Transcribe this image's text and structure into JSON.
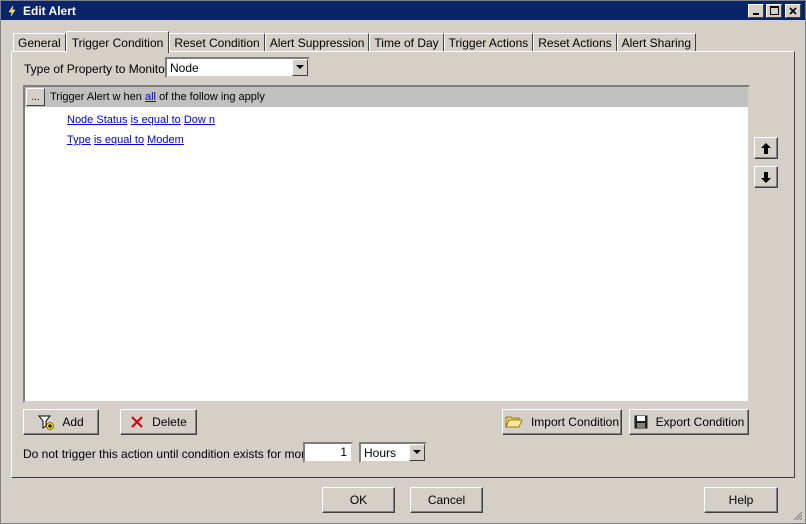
{
  "window": {
    "title": "Edit Alert"
  },
  "tabs": [
    {
      "label": "General"
    },
    {
      "label": "Trigger Condition"
    },
    {
      "label": "Reset Condition"
    },
    {
      "label": "Alert Suppression"
    },
    {
      "label": "Time of Day"
    },
    {
      "label": "Trigger Actions"
    },
    {
      "label": "Reset Actions"
    },
    {
      "label": "Alert Sharing"
    }
  ],
  "active_tab": "Trigger Condition",
  "property": {
    "label": "Type of Property to Monitor:",
    "value": "Node"
  },
  "condition": {
    "ellipsis": "...",
    "header_prefix": "Trigger Alert w hen",
    "header_link": "all",
    "header_suffix": "of the follow ing apply",
    "rules": [
      {
        "field": "Node Status",
        "op": "is equal to",
        "value": "Dow n"
      },
      {
        "field": "Type",
        "op": "is equal to",
        "value": "Modem"
      }
    ]
  },
  "buttons": {
    "add": "Add",
    "delete": "Delete",
    "import": "Import Condition",
    "export": "Export Condition",
    "ok": "OK",
    "cancel": "Cancel",
    "help": "Help"
  },
  "delay": {
    "label": "Do not trigger this action until condition exists for more than",
    "value": "1",
    "unit": "Hours"
  }
}
